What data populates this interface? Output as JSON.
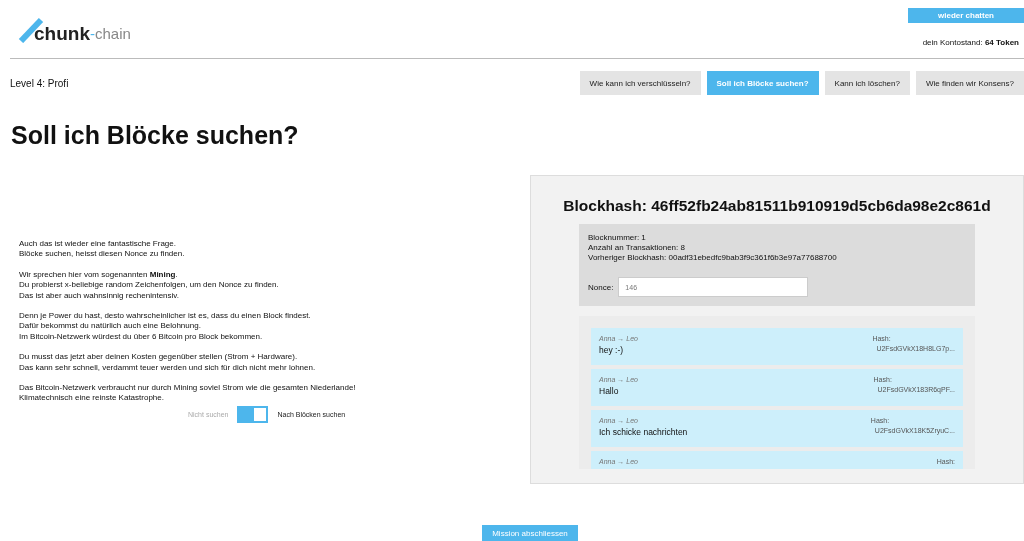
{
  "logo": {
    "word": "chunk",
    "dash": "-",
    "suffix": "chain"
  },
  "header": {
    "chat_button": "wieder chatten",
    "balance_label": "dein Kontostand:",
    "balance_value": "64 Token"
  },
  "level": "Level 4: Profi",
  "nav": [
    {
      "label": "Wie kann ich verschlüsseln?",
      "selected": false
    },
    {
      "label": "Soll ich Blöcke suchen?",
      "selected": true
    },
    {
      "label": "Kann ich löschen?",
      "selected": false
    },
    {
      "label": "Wie finden wir Konsens?",
      "selected": false
    }
  ],
  "title": "Soll ich Blöcke suchen?",
  "paragraphs": [
    [
      "Auch das ist wieder eine fantastische Frage.",
      "Blöcke suchen, heisst diesen Nonce zu finden."
    ],
    [
      "Wir sprechen hier vom sogenannten **Mining**.",
      "Du probierst x-beliebige random Zeichenfolgen, um den Nonce zu finden.",
      "Das ist aber auch wahnsinnig rechenintensiv."
    ],
    [
      "Denn je Power du hast, desto wahrscheinlicher ist es, dass du einen Block findest.",
      "Dafür bekommst du natürlich auch eine Belohnung.",
      "Im Bitcoin-Netzwerk würdest du über 6 Bitcoin pro Block bekommen."
    ],
    [
      "Du musst das jetzt aber deinen Kosten gegenüber stellen (Strom + Hardware).",
      "Das kann sehr schnell, verdammt teuer werden und sich für dich nicht mehr lohnen."
    ],
    [
      "Das Bitcoin-Netzwerk verbraucht nur durch Mining soviel Strom wie die gesamten Niederlande!",
      "Klimatechnisch eine reinste Katastrophe."
    ]
  ],
  "toggle": {
    "off_label": "Nicht suchen",
    "on_label": "Nach Blöcken suchen",
    "on": true
  },
  "block": {
    "title": "Blockhash: 46ff52fb24ab81511b910919d5cb6da98e2c861d",
    "info": [
      "Blocknummer: 1",
      "Anzahl an Transaktionen: 8",
      "Vorheriger Blockhash: 00adf31ebedfc9bab3f9c361f6b3e97a77688700"
    ],
    "nonce_label": "Nonce:",
    "nonce_value": "146",
    "transactions": [
      {
        "route": "Anna → Leo",
        "message": "hey :-)",
        "hash_label": "Hash:",
        "hash": "U2FsdGVkX18H8LG7p..."
      },
      {
        "route": "Anna → Leo",
        "message": "Hallo",
        "hash_label": "Hash:",
        "hash": "U2FsdGVkX183R6qPF..."
      },
      {
        "route": "Anna → Leo",
        "message": "Ich schicke nachrichten",
        "hash_label": "Hash:",
        "hash": "U2FsdGVkX18K5ZryuC..."
      },
      {
        "route": "Anna → Leo",
        "hash_label": "Hash:"
      }
    ]
  },
  "finish_button": "Mission abschliessen"
}
